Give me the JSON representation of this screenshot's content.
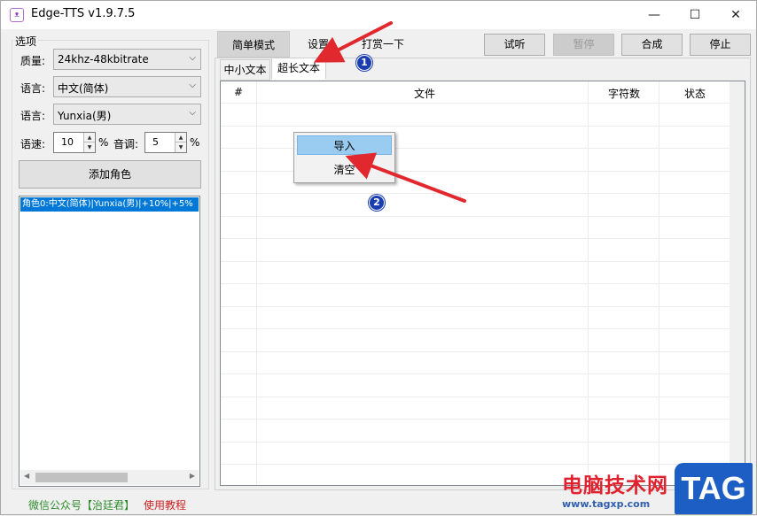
{
  "window": {
    "title": "Edge-TTS v1.9.7.5",
    "icon": "tts-app-icon",
    "minimize": "—",
    "maximize": "☐",
    "close": "✕"
  },
  "options": {
    "group_label": "选项",
    "quality_label": "质量:",
    "quality_value": "24khz-48kbitrate",
    "language_label": "语言:",
    "language_value": "中文(简体)",
    "voice_label": "语言:",
    "voice_value": "Yunxia(男)",
    "speed_label": "语速:",
    "speed_value": "10",
    "speed_unit": "%",
    "pitch_label": "音调:",
    "pitch_value": "5",
    "pitch_unit": "%",
    "add_role_label": "添加角色",
    "roles": [
      "角色0:中文(简体)|Yunxia(男)|+10%|+5%"
    ]
  },
  "footer": {
    "wechat": "微信公众号【治廷君】",
    "tutorial": "使用教程"
  },
  "top_tabs": [
    "简单模式",
    "设置",
    "打赏一下"
  ],
  "toolbar": {
    "listen": "试听",
    "pause": "暂停",
    "synthesize": "合成",
    "stop": "停止"
  },
  "sub_tabs": [
    "中小文本",
    "超长文本"
  ],
  "grid": {
    "columns": [
      "#",
      "文件",
      "字符数",
      "状态"
    ]
  },
  "context_menu": {
    "items": [
      "导入",
      "清空"
    ]
  },
  "annotations": {
    "marker1": "1",
    "marker2": "2",
    "arrow_color": "#e0282e"
  },
  "watermark": {
    "text": "电脑技术网",
    "url": "www.tagxp.com",
    "tag": "TAG"
  },
  "colors": {
    "selection": "#0078d7",
    "menu_highlight": "#99ccf0",
    "footer_green": "#2e8b2e",
    "footer_red": "#cc2222"
  }
}
